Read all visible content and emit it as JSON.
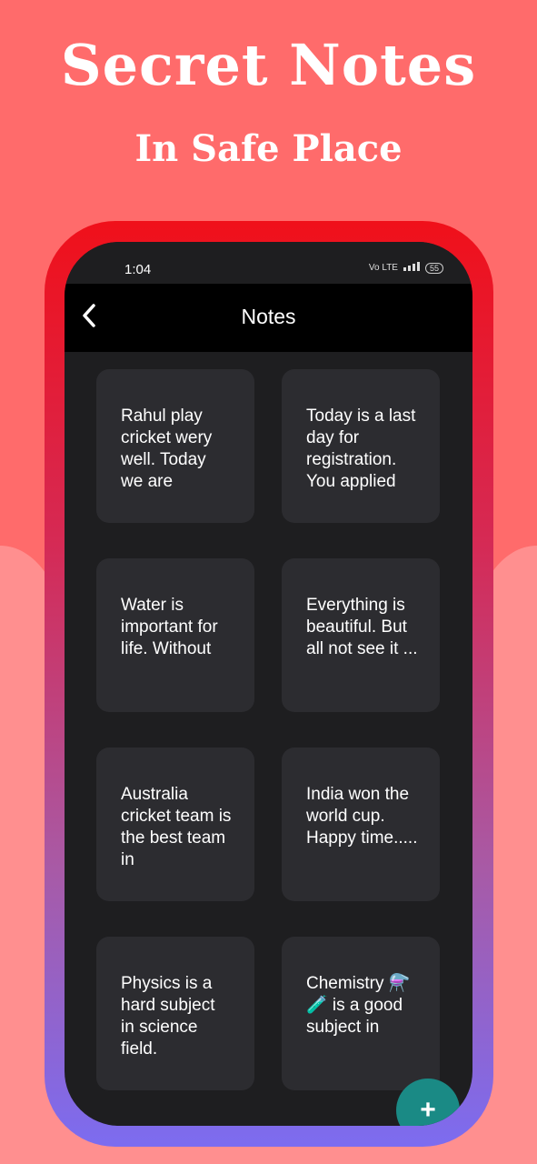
{
  "hero": {
    "title": "Secret Notes",
    "subtitle": "In Safe Place"
  },
  "status_bar": {
    "time": "1:04",
    "network": "Vo LTE",
    "battery": "55"
  },
  "app_bar": {
    "title": "Notes"
  },
  "notes": [
    {
      "text": "Rahul play cricket wery well. Today we are"
    },
    {
      "text": "Today is a last day for registration. You applied"
    },
    {
      "text": "Water is important for life. Without"
    },
    {
      "text": "Everything is beautiful. But all not see it ..."
    },
    {
      "text": "Australia cricket team is the best team in"
    },
    {
      "text": "India won the world cup. Happy time....."
    },
    {
      "text": "Physics is a hard subject in science field."
    },
    {
      "text": "Chemistry ⚗️🧪 is a good subject in"
    }
  ],
  "fab": {
    "label": "+"
  }
}
